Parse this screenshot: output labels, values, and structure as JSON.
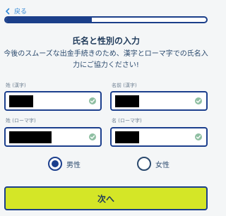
{
  "nav": {
    "back_label": "戻る"
  },
  "progress": {
    "fraction": 0.43
  },
  "form": {
    "title": "氏名と性別の入力",
    "description": "今後のスムーズな出金手続きのため、漢字とローマ字での氏名入力にご協力ください!",
    "fields": {
      "last_kanji": {
        "label": "姓 (漢字)"
      },
      "first_kanji": {
        "label": "名前 (漢字)"
      },
      "last_roman": {
        "label": "姓 (ローマ字)"
      },
      "first_roman": {
        "label": "名 (ローマ字)"
      }
    },
    "gender": {
      "male_label": "男性",
      "female_label": "女性",
      "selected": "male"
    },
    "next_label": "次へ"
  },
  "colors": {
    "accent": "#1b3f8a",
    "button": "#d4e627",
    "check": "#8fbfa2",
    "link": "#2f86d6"
  }
}
